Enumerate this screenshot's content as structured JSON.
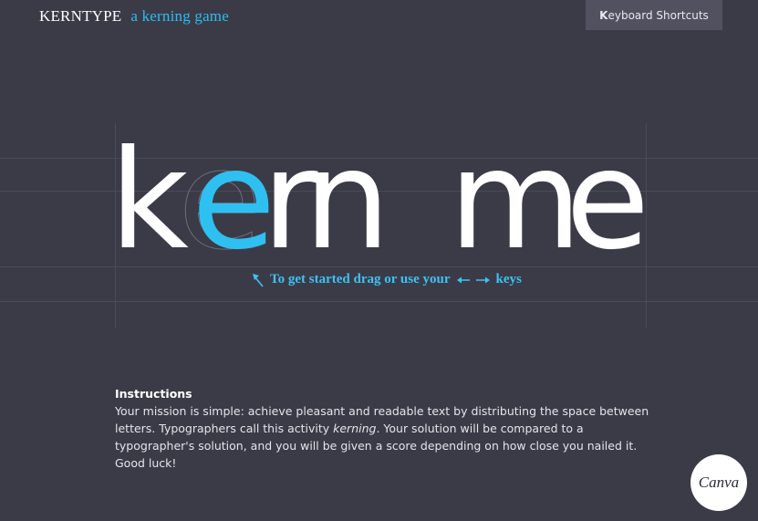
{
  "header": {
    "brand_name": "KERNTYPE",
    "brand_tagline": "a kerning game",
    "shortcuts_button": {
      "first_letter": "K",
      "rest": "eyboard Shortcuts"
    }
  },
  "game": {
    "letters": [
      "k",
      "e",
      "r",
      "n",
      "m",
      "e"
    ],
    "active_letter": "e",
    "ghost_letter": "e",
    "hint_text_before": "To get started drag or use your",
    "hint_text_after": "keys",
    "accent_color": "#2fc0f2"
  },
  "instructions": {
    "heading": "Instructions",
    "text_before": "Your mission is simple: achieve pleasant and readable text by distributing the space between letters. Typographers call this activity ",
    "emphasis": "kerning",
    "text_after": ". Your solution will be compared to a typographer's solution, and you will be given a score depending on how close you nailed it. Good luck!"
  },
  "badge": {
    "label": "Canva"
  }
}
